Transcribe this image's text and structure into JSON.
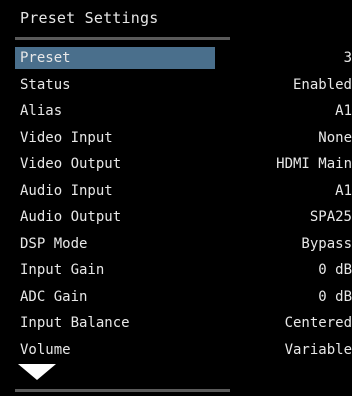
{
  "screen": {
    "title": "Preset Settings"
  },
  "menu": {
    "items": [
      {
        "label": "Preset",
        "value": "3",
        "selected": true
      },
      {
        "label": "Status",
        "value": "Enabled"
      },
      {
        "label": "Alias",
        "value": "A1"
      },
      {
        "label": "Video Input",
        "value": "None"
      },
      {
        "label": "Video Output",
        "value": "HDMI Main"
      },
      {
        "label": "Audio Input",
        "value": "A1"
      },
      {
        "label": "Audio Output",
        "value": "SPA25"
      },
      {
        "label": "DSP Mode",
        "value": "Bypass"
      },
      {
        "label": "Input Gain",
        "value": "0 dB"
      },
      {
        "label": "ADC Gain",
        "value": "0 dB"
      },
      {
        "label": "Input Balance",
        "value": "Centered"
      },
      {
        "label": "Volume",
        "value": "Variable"
      }
    ]
  },
  "indicators": {
    "more_below_icon": "triangle-down-icon"
  },
  "colors": {
    "background": "#000000",
    "text": "#e8e8e8",
    "selection": "#4a6f8c",
    "divider": "#5a5a5a"
  }
}
